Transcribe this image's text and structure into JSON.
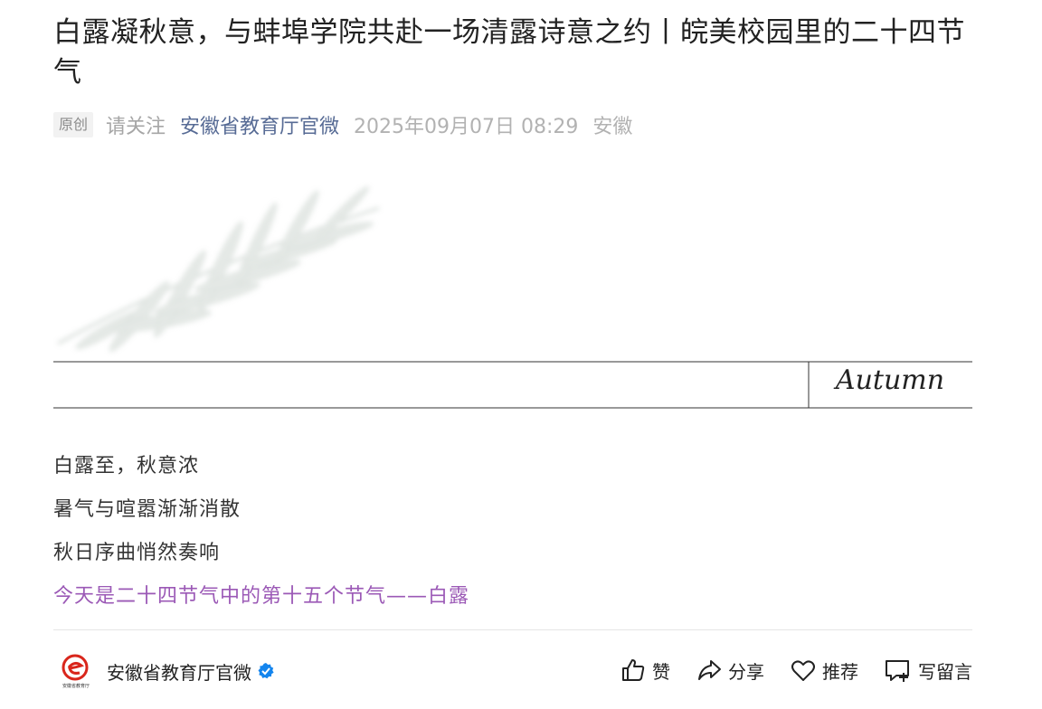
{
  "article": {
    "title": "白露凝秋意，与蚌埠学院共赴一场清露诗意之约丨皖美校园里的二十四节气",
    "original_tag": "原创",
    "follow_text": "请关注",
    "account_name": "安徽省教育厅官微",
    "date": "2025年09月07日 08:29",
    "region": "安徽",
    "banner_word": "Autumn",
    "paragraphs": [
      "白露至，秋意浓",
      "暑气与喧嚣渐渐消散",
      "秋日序曲悄然奏响"
    ],
    "highlight": "今天是二十四节气中的第十五个节气——白露"
  },
  "bottom_bar": {
    "account_name": "安徽省教育厅官微",
    "logo_caption": "安徽省教育厅",
    "like_label": "赞",
    "share_label": "分享",
    "recommend_label": "推荐",
    "comment_label": "写留言"
  },
  "colors": {
    "account_link": "#576b95",
    "highlight_text": "#9b59b6",
    "verified_badge": "#1485ee",
    "logo_red": "#d9261c"
  },
  "icons": [
    "thumbs-up-icon",
    "share-arrow-icon",
    "heart-icon",
    "comment-plus-icon",
    "verified-check-icon"
  ]
}
